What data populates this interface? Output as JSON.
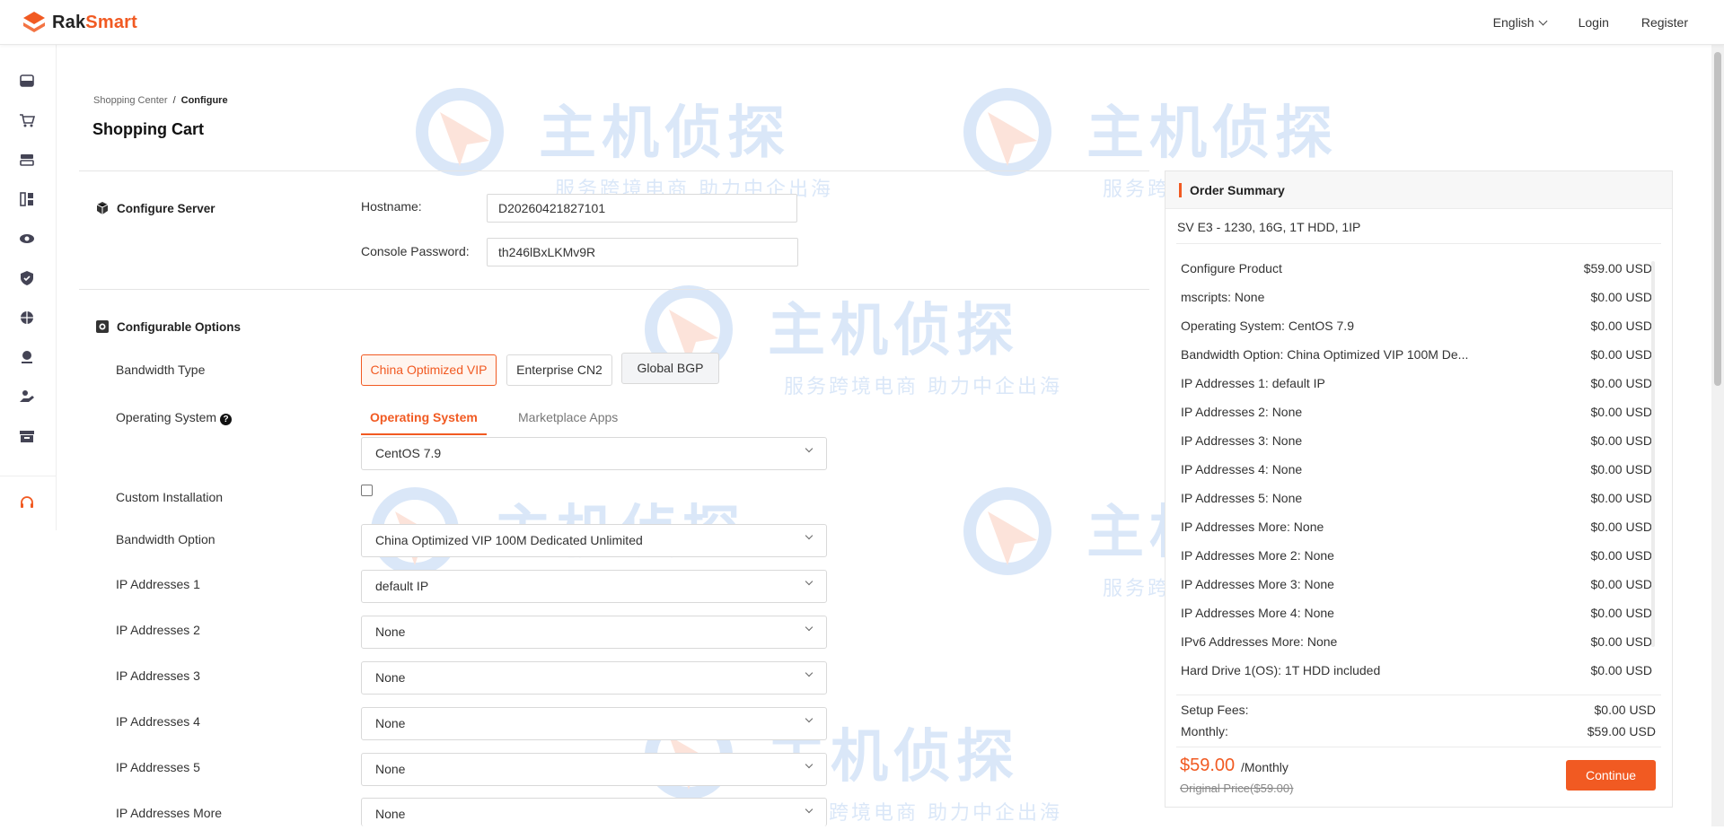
{
  "brand": {
    "name_part1": "Rak",
    "name_part2": "Smart",
    "accent_color": "#f15a22"
  },
  "header": {
    "language": "English",
    "login": "Login",
    "register": "Register"
  },
  "sidebar": {
    "icons": [
      "server-stack-icon",
      "cart-icon",
      "dedicated-server-icon",
      "apps-icon",
      "eye-icon",
      "shield-icon",
      "network-icon",
      "location-icon",
      "hand-service-icon",
      "archive-icon",
      "headset-icon"
    ]
  },
  "breadcrumb": {
    "parent": "Shopping Center",
    "separator": "/",
    "current": "Configure"
  },
  "page": {
    "title": "Shopping Cart"
  },
  "configure_server": {
    "title": "Configure Server",
    "hostname_label": "Hostname:",
    "hostname_value": "D20260421827101",
    "password_label": "Console Password:",
    "password_value": "th246lBxLKMv9R"
  },
  "configurable_options": {
    "title": "Configurable Options",
    "bandwidth_type": {
      "label": "Bandwidth Type",
      "options": [
        "China Optimized VIP",
        "Enterprise CN2",
        "Global BGP"
      ],
      "selected": "China Optimized VIP"
    },
    "operating_system": {
      "label": "Operating System",
      "tabs": [
        "Operating System",
        "Marketplace Apps"
      ],
      "selected": "CentOS 7.9"
    },
    "custom_installation": {
      "label": "Custom Installation",
      "checked": false
    },
    "bandwidth_option": {
      "label": "Bandwidth Option",
      "value": "China Optimized VIP 100M Dedicated Unlimited"
    },
    "ip1": {
      "label": "IP Addresses 1",
      "value": "default IP"
    },
    "ip2": {
      "label": "IP Addresses 2",
      "value": "None"
    },
    "ip3": {
      "label": "IP Addresses 3",
      "value": "None"
    },
    "ip4": {
      "label": "IP Addresses 4",
      "value": "None"
    },
    "ip5": {
      "label": "IP Addresses 5",
      "value": "None"
    },
    "ip_more": {
      "label": "IP Addresses More",
      "value": "None"
    }
  },
  "order_summary": {
    "title": "Order Summary",
    "product": "SV E3 - 1230, 16G, 1T HDD, 1IP",
    "lines": [
      {
        "label": "Configure Product",
        "value": "$59.00 USD"
      },
      {
        "label": "mscripts: None",
        "value": "$0.00 USD"
      },
      {
        "label": "Operating System: CentOS 7.9",
        "value": "$0.00 USD"
      },
      {
        "label": "Bandwidth Option: China Optimized VIP 100M De...",
        "value": "$0.00 USD"
      },
      {
        "label": "IP Addresses 1: default IP",
        "value": "$0.00 USD"
      },
      {
        "label": "IP Addresses 2: None",
        "value": "$0.00 USD"
      },
      {
        "label": "IP Addresses 3: None",
        "value": "$0.00 USD"
      },
      {
        "label": "IP Addresses 4: None",
        "value": "$0.00 USD"
      },
      {
        "label": "IP Addresses 5: None",
        "value": "$0.00 USD"
      },
      {
        "label": "IP Addresses More: None",
        "value": "$0.00 USD"
      },
      {
        "label": "IP Addresses More 2: None",
        "value": "$0.00 USD"
      },
      {
        "label": "IP Addresses More 3: None",
        "value": "$0.00 USD"
      },
      {
        "label": "IP Addresses More 4: None",
        "value": "$0.00 USD"
      },
      {
        "label": "IPv6 Addresses More: None",
        "value": "$0.00 USD"
      },
      {
        "label": "Hard Drive 1(OS): 1T HDD included",
        "value": "$0.00 USD"
      }
    ],
    "setup_fees_label": "Setup Fees:",
    "setup_fees_value": "$0.00 USD",
    "monthly_label": "Monthly:",
    "monthly_value": "$59.00 USD",
    "price": "$59.00",
    "period": "/Monthly",
    "original_price": "Original Price($59.00)",
    "continue": "Continue"
  },
  "watermark": {
    "title": "主机侦探",
    "slogan": "服务跨境电商 助力中企出海"
  }
}
